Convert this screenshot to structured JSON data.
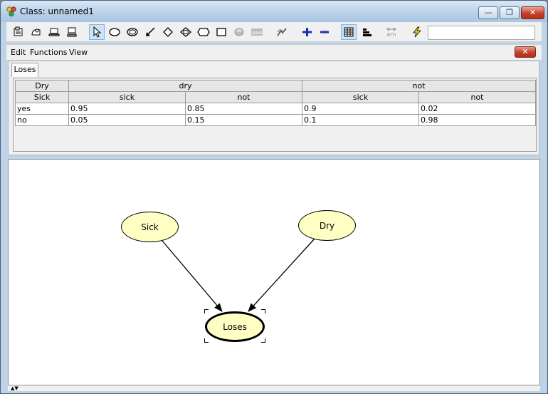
{
  "window": {
    "title": "Class: unnamed1"
  },
  "menu": {
    "items": [
      "Edit",
      "Functions",
      "View"
    ]
  },
  "toolbar": {
    "tools": [
      "node-properties-icon",
      "open-icon",
      "laptop-icon",
      "computer-icon",
      "select-pointer-icon",
      "chance-node-icon",
      "discrete-decision-icon",
      "arrow-link-icon",
      "decision-node-icon",
      "utility-node-icon",
      "instance-node-icon",
      "rectangle-icon",
      "database-icon",
      "label-icon",
      "align-icon",
      "zoom-in-icon",
      "zoom-out-icon",
      "table-view-icon",
      "bar-chart-icon",
      "em-learning-icon",
      "compile-icon"
    ],
    "selected_tool": "select-pointer-icon",
    "search_value": ""
  },
  "panel": {
    "tab_label": "Loses",
    "table": {
      "parent_headers": [
        "Dry",
        "Sick"
      ],
      "dry_states": [
        "dry",
        "not"
      ],
      "sick_states": [
        "sick",
        "not",
        "sick",
        "not"
      ],
      "rows": [
        {
          "state": "yes",
          "values": [
            "0.95",
            "0.85",
            "0.9",
            "0.02"
          ]
        },
        {
          "state": "no",
          "values": [
            "0.05",
            "0.15",
            "0.1",
            "0.98"
          ]
        }
      ]
    }
  },
  "graph": {
    "nodes": [
      {
        "id": "sick",
        "label": "Sick"
      },
      {
        "id": "dry",
        "label": "Dry"
      },
      {
        "id": "loses",
        "label": "Loses",
        "selected": true
      }
    ],
    "edges": [
      {
        "from": "sick",
        "to": "loses"
      },
      {
        "from": "dry",
        "to": "loses"
      }
    ],
    "colors": {
      "node_fill": "#ffffc4",
      "edge": "#000000"
    }
  }
}
